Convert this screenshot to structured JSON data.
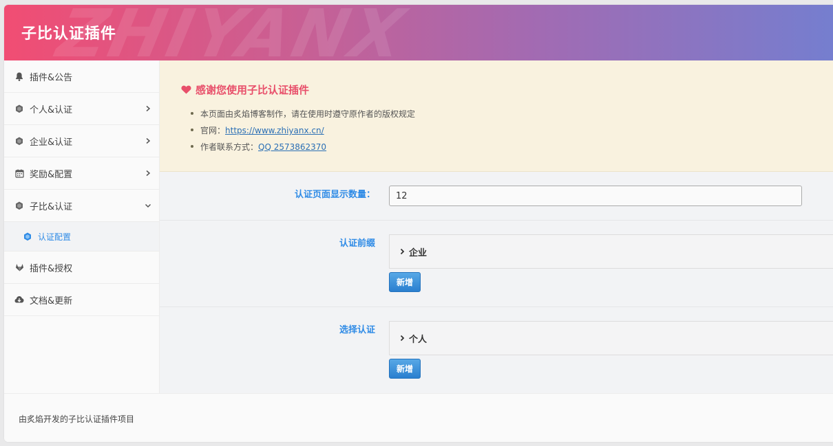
{
  "header": {
    "title": "子比认证插件",
    "watermark": "ZHIYANX"
  },
  "sidebar": {
    "items": [
      {
        "label": "插件&公告",
        "icon": "bell-icon"
      },
      {
        "label": "个人&认证",
        "icon": "hexagon-icon",
        "chevron": "right"
      },
      {
        "label": "企业&认证",
        "icon": "hexagon-icon",
        "chevron": "right"
      },
      {
        "label": "奖励&配置",
        "icon": "calendar-icon",
        "chevron": "right"
      },
      {
        "label": "子比&认证",
        "icon": "hexagon-icon",
        "chevron": "down"
      },
      {
        "label": "插件&授权",
        "icon": "gitlab-icon"
      },
      {
        "label": "文档&更新",
        "icon": "cloud-download-icon"
      }
    ],
    "sub_item": {
      "label": "认证配置",
      "icon": "hexagon-icon"
    }
  },
  "notice": {
    "heading": "感谢您使用子比认证插件",
    "line1": "本页面由炙焰博客制作，请在使用时遵守原作者的版权规定",
    "line2_prefix": "官网：",
    "line2_link": "https://www.zhiyanx.cn/",
    "line3_prefix": "作者联系方式：",
    "line3_link": "QQ 2573862370"
  },
  "form": {
    "count_label": "认证页面显示数量：",
    "count_value": "12",
    "prefix_label": "认证前缀",
    "prefix_group": "企业",
    "select_label": "选择认证",
    "select_group": "个人",
    "add_label": "新增"
  },
  "footer": {
    "text": "由炙焰开发的子比认证插件项目"
  },
  "colors": {
    "accent": "#2f8be6",
    "notice_heading": "#e84f6a",
    "header_start": "#f14d73",
    "header_end": "#757ecf"
  }
}
